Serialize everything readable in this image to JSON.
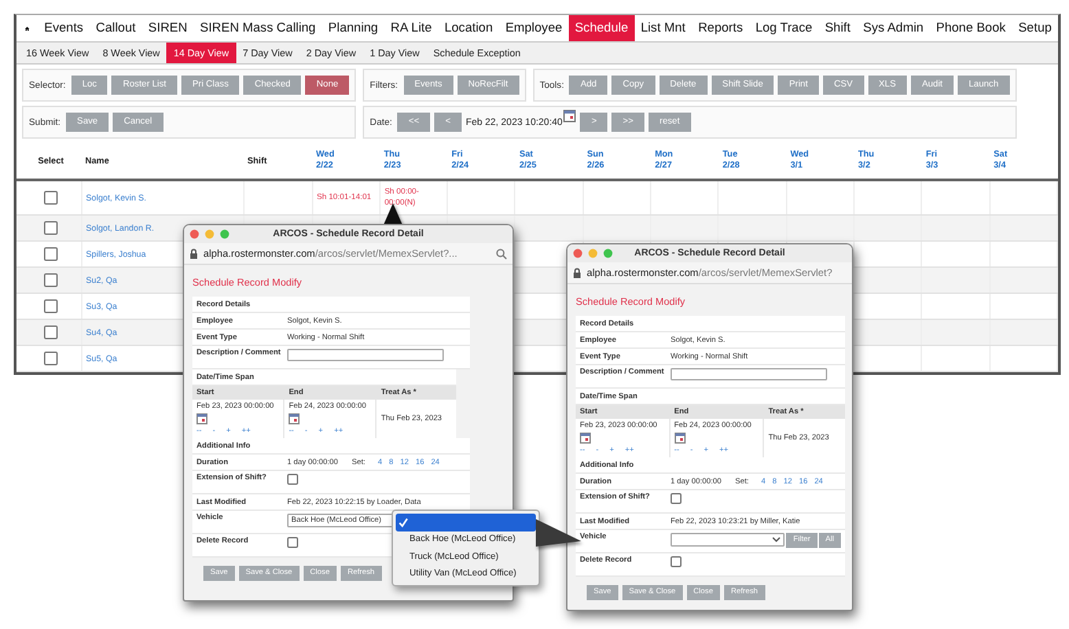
{
  "nav": {
    "items": [
      {
        "label": "Events",
        "selected": false
      },
      {
        "label": "Callout",
        "selected": false
      },
      {
        "label": "SIREN",
        "selected": false
      },
      {
        "label": "SIREN Mass Calling",
        "selected": false
      },
      {
        "label": "Planning",
        "selected": false
      },
      {
        "label": "RA Lite",
        "selected": false
      },
      {
        "label": "Location",
        "selected": false
      },
      {
        "label": "Employee",
        "selected": false
      },
      {
        "label": "Schedule",
        "selected": true
      },
      {
        "label": "List Mnt",
        "selected": false
      },
      {
        "label": "Reports",
        "selected": false
      },
      {
        "label": "Log Trace",
        "selected": false
      },
      {
        "label": "Shift",
        "selected": false
      },
      {
        "label": "Sys Admin",
        "selected": false
      },
      {
        "label": "Phone Book",
        "selected": false
      },
      {
        "label": "Setup",
        "selected": false
      }
    ]
  },
  "view_tabs": [
    {
      "label": "16 Week View",
      "selected": false
    },
    {
      "label": "8 Week View",
      "selected": false
    },
    {
      "label": "14 Day View",
      "selected": true
    },
    {
      "label": "7 Day View",
      "selected": false
    },
    {
      "label": "2 Day View",
      "selected": false
    },
    {
      "label": "1 Day View",
      "selected": false
    },
    {
      "label": "Schedule Exception",
      "selected": false
    }
  ],
  "selector": {
    "label": "Selector:",
    "options": [
      {
        "label": "Loc",
        "selected": false
      },
      {
        "label": "Roster List",
        "selected": false
      },
      {
        "label": "Pri Class",
        "selected": false
      },
      {
        "label": "Checked",
        "selected": false
      },
      {
        "label": "None",
        "selected": true
      }
    ]
  },
  "filters": {
    "label": "Filters:",
    "buttons": [
      "Events",
      "NoRecFilt"
    ]
  },
  "tools": {
    "label": "Tools:",
    "buttons": [
      "Add",
      "Copy",
      "Delete",
      "Shift Slide",
      "Print",
      "CSV",
      "XLS",
      "Audit",
      "Launch"
    ]
  },
  "submit": {
    "label": "Submit:",
    "buttons": [
      "Save",
      "Cancel"
    ]
  },
  "date": {
    "label": "Date:",
    "back_buttons": [
      "<<",
      "<"
    ],
    "value": "Feb 22, 2023 10:20:40",
    "forward_buttons": [
      ">",
      ">>",
      "reset"
    ]
  },
  "table": {
    "columns": [
      "Select",
      "Name",
      "Shift"
    ],
    "days": [
      {
        "day": "Wed",
        "date": "2/22"
      },
      {
        "day": "Thu",
        "date": "2/23"
      },
      {
        "day": "Fri",
        "date": "2/24"
      },
      {
        "day": "Sat",
        "date": "2/25"
      },
      {
        "day": "Sun",
        "date": "2/26"
      },
      {
        "day": "Mon",
        "date": "2/27"
      },
      {
        "day": "Tue",
        "date": "2/28"
      },
      {
        "day": "Wed",
        "date": "3/1"
      },
      {
        "day": "Thu",
        "date": "3/2"
      },
      {
        "day": "Fri",
        "date": "3/3"
      },
      {
        "day": "Sat",
        "date": "3/4"
      }
    ],
    "rows": [
      {
        "name": "Solgot, Kevin S.",
        "checked": false,
        "shift_cells": [
          "Sh 10:01-14:01",
          "Sh 00:00-00:00(N)"
        ]
      },
      {
        "name": "Solgot, Landon R.",
        "checked": false
      },
      {
        "name": "Spillers, Joshua",
        "checked": false
      },
      {
        "name": "Su2, Qa",
        "checked": false
      },
      {
        "name": "Su3, Qa",
        "checked": false
      },
      {
        "name": "Su4, Qa",
        "checked": false
      },
      {
        "name": "Su5, Qa",
        "checked": false
      }
    ]
  },
  "windows": [
    {
      "title": "ARCOS - Schedule Record Detail",
      "url_host": "alpha.rostermonster.com",
      "url_path": "/arcos/servlet/MemexServlet?...",
      "heading": "Schedule Record Modify",
      "record_section": "Record Details",
      "employee_label": "Employee",
      "employee": "Solgot, Kevin S.",
      "event_type_label": "Event Type",
      "event_type": "Working - Normal Shift",
      "comment_label": "Description / Comment",
      "span_section": "Date/Time Span",
      "span_columns": [
        "Start",
        "End",
        "Treat As *"
      ],
      "start": "Feb 23, 2023 00:00:00",
      "start_links": [
        "--",
        "-",
        "+",
        "++"
      ],
      "end": "Feb 24, 2023 00:00:00",
      "end_links": [
        "--",
        "-",
        "+",
        "++"
      ],
      "treat_as": "Thu Feb 23, 2023",
      "info_section": "Additional Info",
      "duration_label": "Duration",
      "duration": "1 day 00:00:00",
      "set_label": "Set:",
      "set_links": [
        "4",
        "8",
        "12",
        "16",
        "24"
      ],
      "extension_label": "Extension of Shift?",
      "extension_checked": false,
      "modified_label": "Last Modified",
      "modified": "Feb 22, 2023 10:22:15 by Loader, Data",
      "vehicle_label": "Vehicle",
      "vehicle": "Back Hoe (McLeod Office)",
      "delete_label": "Delete Record",
      "delete_checked": false,
      "buttons": [
        "Save",
        "Save & Close",
        "Close",
        "Refresh"
      ]
    },
    {
      "title": "ARCOS - Schedule Record Detail",
      "url_host": "alpha.rostermonster.com",
      "url_path": "/arcos/servlet/MemexServlet?",
      "heading": "Schedule Record Modify",
      "record_section": "Record Details",
      "employee_label": "Employee",
      "employee": "Solgot, Kevin S.",
      "event_type_label": "Event Type",
      "event_type": "Working - Normal Shift",
      "comment_label": "Description / Comment",
      "span_section": "Date/Time Span",
      "span_columns": [
        "Start",
        "End",
        "Treat As *"
      ],
      "start": "Feb 23, 2023 00:00:00",
      "start_links": [
        "--",
        "-",
        "+",
        "++"
      ],
      "end": "Feb 24, 2023 00:00:00",
      "end_links": [
        "--",
        "-",
        "+",
        "++"
      ],
      "treat_as": "Thu Feb 23, 2023",
      "info_section": "Additional Info",
      "duration_label": "Duration",
      "duration": "1 day 00:00:00",
      "set_label": "Set:",
      "set_links": [
        "4",
        "8",
        "12",
        "16",
        "24"
      ],
      "extension_label": "Extension of Shift?",
      "extension_checked": false,
      "modified_label": "Last Modified",
      "modified": "Feb 22, 2023 10:23:21 by Miller, Katie",
      "vehicle_label": "Vehicle",
      "vehicle_buttons": [
        "Filter",
        "All"
      ],
      "delete_label": "Delete Record",
      "delete_checked": false,
      "buttons": [
        "Save",
        "Save & Close",
        "Close",
        "Refresh"
      ]
    }
  ],
  "vehicle_menu": {
    "options": [
      {
        "selected": true
      },
      {
        "label": "Back Hoe (McLeod Office)",
        "selected": false
      },
      {
        "label": "Truck (McLeod Office)",
        "selected": false
      },
      {
        "label": "Utility Van (McLeod Office)",
        "selected": false
      }
    ]
  }
}
